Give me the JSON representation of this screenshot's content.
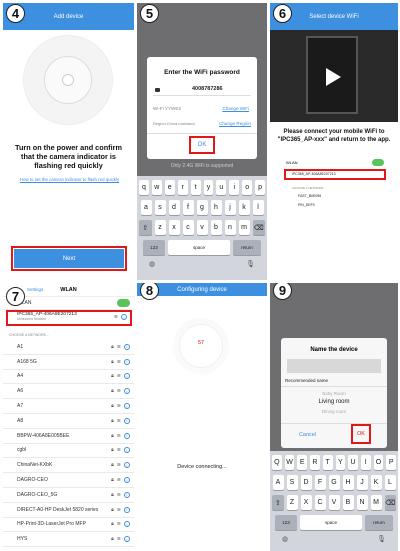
{
  "p4": {
    "num": "4",
    "title": "Add device",
    "instruction": "Turn on the power and confirm that the camera indicator is flashing red quickly",
    "link": "How to set the camera indicator to flash red quickly",
    "next": "Next"
  },
  "p5": {
    "num": "5",
    "dialog_title": "Enter the WiFi password",
    "password": "4008787286",
    "ssid": "Wi-Fi YYWE3",
    "change_wifi": "Change WiFi",
    "region": "Region:China mainland",
    "change_region": "Change Region",
    "ok": "OK",
    "note": "Only 2.4G WiFi is supported",
    "kb_row1": [
      "q",
      "w",
      "e",
      "r",
      "t",
      "y",
      "u",
      "i",
      "o",
      "p"
    ],
    "kb_row2": [
      "a",
      "s",
      "d",
      "f",
      "g",
      "h",
      "j",
      "k",
      "l"
    ],
    "kb_row3": [
      "z",
      "x",
      "c",
      "v",
      "b",
      "n",
      "m"
    ],
    "kb_num": "123",
    "kb_space": "space",
    "kb_return": "return"
  },
  "p6": {
    "num": "6",
    "title": "Select device WiFi",
    "instruction": "Please connect your mobile WiFi to \"IPC365_AP-xxx\" and return to the app.",
    "wlan": "WLAN",
    "network": "IPC365_AP-406A8E207213",
    "choose": "CHOOSE A NETWORK...",
    "net2": "FAST_B0E096",
    "net3": "PIN_DEF0"
  },
  "p7": {
    "num": "7",
    "back": "Settings",
    "title": "WLAN",
    "wlan": "WLAN",
    "network": "IPC365_AP-406A8E207213",
    "network_sub": "Unsecured Network",
    "choose": "CHOOSE A NETWORK...",
    "networks": [
      "A1",
      "A168 5G",
      "A4",
      "A6",
      "A7",
      "A8",
      "BBPW-406A8E005BEE",
      "cgbl",
      "ChinaNet-KXbK",
      "DAGRO-CEO",
      "DAGRO-CEO_5G",
      "DIRECT-A0-HP DeskJet 5820 series",
      "HP-Print-3D-LaserJet Pro MFP",
      "HYS"
    ]
  },
  "p8": {
    "num": "8",
    "title": "Configuring device",
    "count": "57",
    "status": "Device connecting..."
  },
  "p9": {
    "num": "9",
    "dialog_title": "Name the device",
    "recommended": "Recommended name",
    "names": [
      "Baby Room",
      "Living room",
      "Dining room"
    ],
    "cancel": "Cancel",
    "ok": "OK",
    "kb_row1": [
      "Q",
      "W",
      "E",
      "R",
      "T",
      "Y",
      "U",
      "I",
      "O",
      "P"
    ],
    "kb_row2": [
      "A",
      "S",
      "D",
      "F",
      "G",
      "H",
      "J",
      "K",
      "L"
    ],
    "kb_row3": [
      "Z",
      "X",
      "C",
      "V",
      "B",
      "N",
      "M"
    ],
    "kb_num": "123",
    "kb_space": "space",
    "kb_return": "return"
  },
  "colors": {
    "accent": "#3d8fe0",
    "highlight": "#e01818",
    "toggle": "#5ac35a"
  }
}
